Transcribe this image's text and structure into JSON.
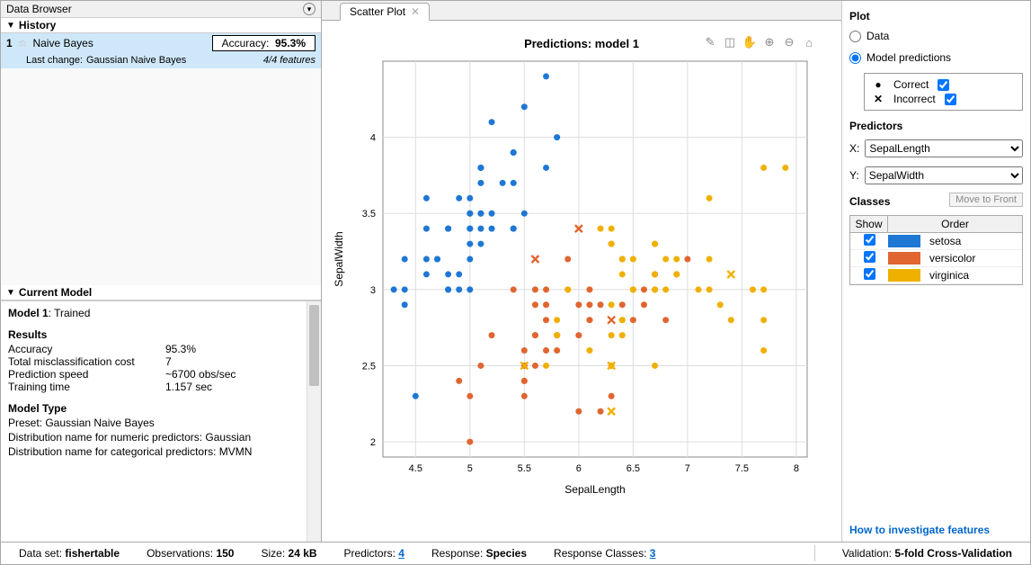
{
  "left": {
    "title": "Data Browser",
    "history_header": "History",
    "history": {
      "index": "1",
      "name": "Naive Bayes",
      "accuracy_label": "Accuracy:",
      "accuracy_value": "95.3%",
      "lastchange_label": "Last change:",
      "lastchange_value": "Gaussian Naive Bayes",
      "features": "4/4 features"
    },
    "current_header": "Current Model",
    "current": {
      "title": "Model 1",
      "title_suffix": ": Trained",
      "results_hdr": "Results",
      "rows": [
        {
          "k": "Accuracy",
          "v": "95.3%"
        },
        {
          "k": "Total misclassification cost",
          "v": "7"
        },
        {
          "k": "Prediction speed",
          "v": "~6700 obs/sec"
        },
        {
          "k": "Training time",
          "v": "1.157 sec"
        }
      ],
      "type_hdr": "Model Type",
      "type_lines": [
        "Preset: Gaussian Naive Bayes",
        "Distribution name for numeric predictors: Gaussian",
        "Distribution name for categorical predictors: MVMN"
      ]
    }
  },
  "tab": {
    "label": "Scatter Plot"
  },
  "plot": {
    "title": "Predictions: model 1",
    "xlabel": "SepalLength",
    "ylabel": "SepalWidth"
  },
  "right": {
    "plot_hdr": "Plot",
    "radio_data": "Data",
    "radio_pred": "Model predictions",
    "legend_correct": "Correct",
    "legend_incorrect": "Incorrect",
    "pred_hdr": "Predictors",
    "x_label": "X:",
    "y_label": "Y:",
    "x_value": "SepalLength",
    "y_value": "SepalWidth",
    "classes_hdr": "Classes",
    "move_btn": "Move to Front",
    "col_show": "Show",
    "col_order": "Order",
    "classes": [
      {
        "name": "setosa",
        "color": "#1f77d4"
      },
      {
        "name": "versicolor",
        "color": "#e06530"
      },
      {
        "name": "virginica",
        "color": "#f0b000"
      }
    ],
    "help": "How to investigate features"
  },
  "status": {
    "dataset_lbl": "Data set:",
    "dataset": "fishertable",
    "obs_lbl": "Observations:",
    "obs": "150",
    "size_lbl": "Size:",
    "size": "24 kB",
    "pred_lbl": "Predictors:",
    "pred": "4",
    "resp_lbl": "Response:",
    "resp": "Species",
    "respcls_lbl": "Response Classes:",
    "respcls": "3",
    "valid_lbl": "Validation:",
    "valid": "5-fold Cross-Validation"
  },
  "chart_data": {
    "type": "scatter",
    "title": "Predictions: model 1",
    "xlabel": "SepalLength",
    "ylabel": "SepalWidth",
    "xlim": [
      4.2,
      8.1
    ],
    "ylim": [
      1.9,
      4.5
    ],
    "xticks": [
      4.5,
      5,
      5.5,
      6,
      6.5,
      7,
      7.5,
      8
    ],
    "yticks": [
      2,
      2.5,
      3,
      3.5,
      4
    ],
    "series": [
      {
        "name": "setosa",
        "color": "#1f77d4",
        "correct": [
          [
            5.1,
            3.5
          ],
          [
            4.9,
            3.0
          ],
          [
            4.7,
            3.2
          ],
          [
            4.6,
            3.1
          ],
          [
            5.0,
            3.6
          ],
          [
            5.4,
            3.9
          ],
          [
            4.6,
            3.4
          ],
          [
            5.0,
            3.4
          ],
          [
            4.4,
            2.9
          ],
          [
            4.9,
            3.1
          ],
          [
            5.4,
            3.7
          ],
          [
            4.8,
            3.4
          ],
          [
            4.8,
            3.0
          ],
          [
            4.3,
            3.0
          ],
          [
            5.8,
            4.0
          ],
          [
            5.7,
            4.4
          ],
          [
            5.4,
            3.9
          ],
          [
            5.1,
            3.5
          ],
          [
            5.7,
            3.8
          ],
          [
            5.1,
            3.8
          ],
          [
            5.4,
            3.4
          ],
          [
            5.1,
            3.7
          ],
          [
            4.6,
            3.6
          ],
          [
            5.1,
            3.3
          ],
          [
            4.8,
            3.4
          ],
          [
            5.0,
            3.0
          ],
          [
            5.0,
            3.4
          ],
          [
            5.2,
            3.5
          ],
          [
            5.2,
            3.4
          ],
          [
            4.7,
            3.2
          ],
          [
            4.8,
            3.1
          ],
          [
            5.4,
            3.4
          ],
          [
            5.2,
            4.1
          ],
          [
            5.5,
            4.2
          ],
          [
            5.0,
            3.2
          ],
          [
            5.5,
            3.5
          ],
          [
            4.9,
            3.6
          ],
          [
            4.4,
            3.0
          ],
          [
            5.1,
            3.4
          ],
          [
            5.0,
            3.5
          ],
          [
            4.5,
            2.3
          ],
          [
            4.4,
            3.2
          ],
          [
            5.0,
            3.5
          ],
          [
            5.1,
            3.8
          ],
          [
            4.8,
            3.0
          ],
          [
            5.1,
            3.8
          ],
          [
            4.6,
            3.2
          ],
          [
            5.3,
            3.7
          ],
          [
            5.0,
            3.3
          ]
        ],
        "incorrect": []
      },
      {
        "name": "versicolor",
        "color": "#e06530",
        "correct": [
          [
            7.0,
            3.2
          ],
          [
            6.4,
            3.2
          ],
          [
            6.9,
            3.1
          ],
          [
            5.5,
            2.3
          ],
          [
            6.5,
            2.8
          ],
          [
            5.7,
            2.8
          ],
          [
            6.3,
            3.3
          ],
          [
            4.9,
            2.4
          ],
          [
            6.6,
            2.9
          ],
          [
            5.2,
            2.7
          ],
          [
            5.0,
            2.0
          ],
          [
            5.9,
            3.0
          ],
          [
            6.0,
            2.2
          ],
          [
            6.1,
            2.9
          ],
          [
            5.6,
            2.9
          ],
          [
            6.7,
            3.1
          ],
          [
            5.6,
            3.0
          ],
          [
            5.8,
            2.7
          ],
          [
            6.2,
            2.2
          ],
          [
            5.6,
            2.5
          ],
          [
            5.9,
            3.2
          ],
          [
            6.1,
            2.8
          ],
          [
            6.3,
            2.5
          ],
          [
            6.1,
            2.8
          ],
          [
            6.4,
            2.9
          ],
          [
            6.6,
            3.0
          ],
          [
            6.8,
            2.8
          ],
          [
            6.7,
            3.0
          ],
          [
            6.0,
            2.9
          ],
          [
            5.7,
            2.6
          ],
          [
            5.5,
            2.4
          ],
          [
            5.5,
            2.4
          ],
          [
            5.8,
            2.7
          ],
          [
            6.0,
            2.7
          ],
          [
            5.4,
            3.0
          ],
          [
            6.7,
            3.1
          ],
          [
            6.3,
            2.3
          ],
          [
            5.6,
            2.7
          ],
          [
            5.5,
            2.5
          ],
          [
            5.5,
            2.6
          ],
          [
            6.1,
            3.0
          ],
          [
            5.8,
            2.6
          ],
          [
            5.0,
            2.3
          ],
          [
            5.6,
            2.7
          ],
          [
            5.7,
            3.0
          ],
          [
            5.7,
            2.9
          ],
          [
            6.2,
            2.9
          ],
          [
            5.1,
            2.5
          ]
        ],
        "incorrect": [
          [
            5.6,
            3.2
          ],
          [
            6.0,
            3.4
          ],
          [
            6.3,
            2.8
          ]
        ]
      },
      {
        "name": "virginica",
        "color": "#f0b000",
        "correct": [
          [
            6.3,
            3.3
          ],
          [
            5.8,
            2.7
          ],
          [
            7.1,
            3.0
          ],
          [
            6.3,
            2.9
          ],
          [
            6.5,
            3.0
          ],
          [
            7.6,
            3.0
          ],
          [
            7.3,
            2.9
          ],
          [
            6.7,
            2.5
          ],
          [
            7.2,
            3.6
          ],
          [
            6.5,
            3.2
          ],
          [
            6.4,
            2.7
          ],
          [
            6.8,
            3.0
          ],
          [
            5.7,
            2.5
          ],
          [
            5.8,
            2.8
          ],
          [
            6.4,
            3.2
          ],
          [
            6.5,
            3.0
          ],
          [
            7.7,
            3.8
          ],
          [
            7.7,
            2.6
          ],
          [
            6.9,
            3.2
          ],
          [
            7.7,
            2.8
          ],
          [
            6.3,
            2.7
          ],
          [
            6.7,
            3.3
          ],
          [
            7.2,
            3.2
          ],
          [
            6.4,
            2.8
          ],
          [
            7.2,
            3.0
          ],
          [
            7.4,
            2.8
          ],
          [
            7.9,
            3.8
          ],
          [
            6.4,
            2.8
          ],
          [
            6.1,
            2.6
          ],
          [
            7.7,
            3.0
          ],
          [
            6.3,
            3.4
          ],
          [
            6.4,
            3.1
          ],
          [
            6.9,
            3.1
          ],
          [
            6.7,
            3.1
          ],
          [
            6.9,
            3.1
          ],
          [
            5.8,
            2.7
          ],
          [
            6.8,
            3.2
          ],
          [
            6.7,
            3.3
          ],
          [
            6.7,
            3.0
          ],
          [
            6.3,
            2.5
          ],
          [
            6.5,
            3.0
          ],
          [
            6.2,
            3.4
          ],
          [
            5.9,
            3.0
          ]
        ],
        "incorrect": [
          [
            5.5,
            2.5
          ],
          [
            6.3,
            2.2
          ],
          [
            7.4,
            3.1
          ],
          [
            6.3,
            2.5
          ]
        ]
      }
    ]
  }
}
